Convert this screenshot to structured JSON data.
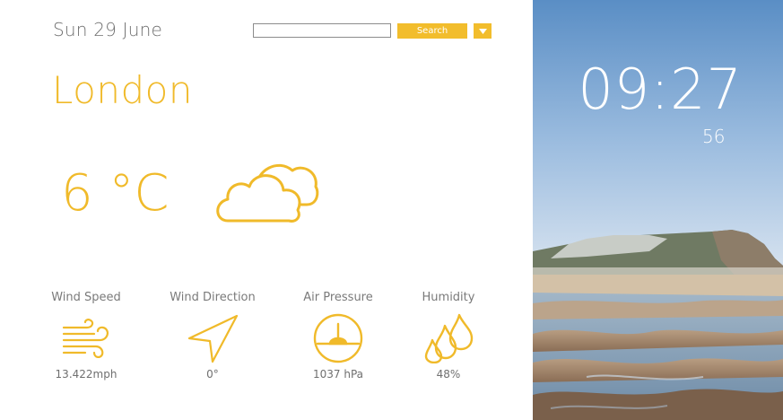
{
  "header": {
    "date": "Sun 29 June",
    "search_placeholder": "",
    "search_label": "Search"
  },
  "weather": {
    "city": "London",
    "temperature": "6 °C",
    "condition_icon": "clouds-icon"
  },
  "stats": [
    {
      "label": "Wind Speed",
      "value": "13.422mph",
      "icon": "wind-icon"
    },
    {
      "label": "Wind Direction",
      "value": "0°",
      "icon": "direction-arrow-icon"
    },
    {
      "label": "Air Pressure",
      "value": "1037 hPa",
      "icon": "gauge-icon"
    },
    {
      "label": "Humidity",
      "value": "48%",
      "icon": "water-drops-icon"
    }
  ],
  "clock": {
    "time": "09:27",
    "seconds": "56"
  },
  "colors": {
    "accent": "#f0ba2a",
    "text_gray": "#6f6f6f"
  }
}
